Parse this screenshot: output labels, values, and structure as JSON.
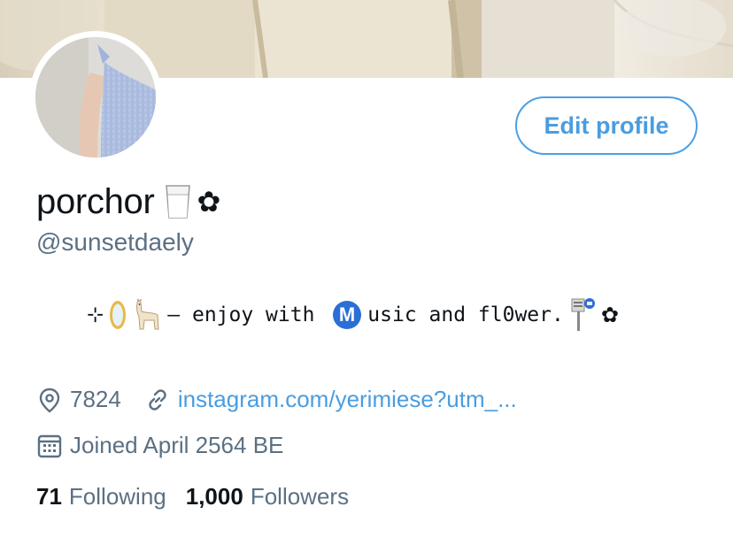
{
  "profile": {
    "display_name": "porchor",
    "name_emoji_milk": "milk-glass-icon",
    "name_flower": "✿",
    "handle": "@sunsetdaely",
    "edit_profile_label": "Edit profile",
    "bio": {
      "prefix_glyph": "⊹",
      "mirror_icon": "mirror-icon",
      "llama_icon": "llama-icon",
      "text_part1": "– enjoy with ",
      "metro_icon_letter": "M",
      "text_part2": "usic and fl0wer.",
      "bus_stop_icon": "bus-stop-icon",
      "suffix_flower": "✿"
    },
    "location": "7824",
    "website": "instagram.com/yerimiese?utm_...",
    "joined": "Joined April 2564 BE",
    "following_count": "71",
    "following_label": "Following",
    "followers_count": "1,000",
    "followers_label": "Followers"
  },
  "colors": {
    "accent": "#4a9de0",
    "secondary_text": "#5b7083",
    "primary_text": "#0f1419"
  }
}
